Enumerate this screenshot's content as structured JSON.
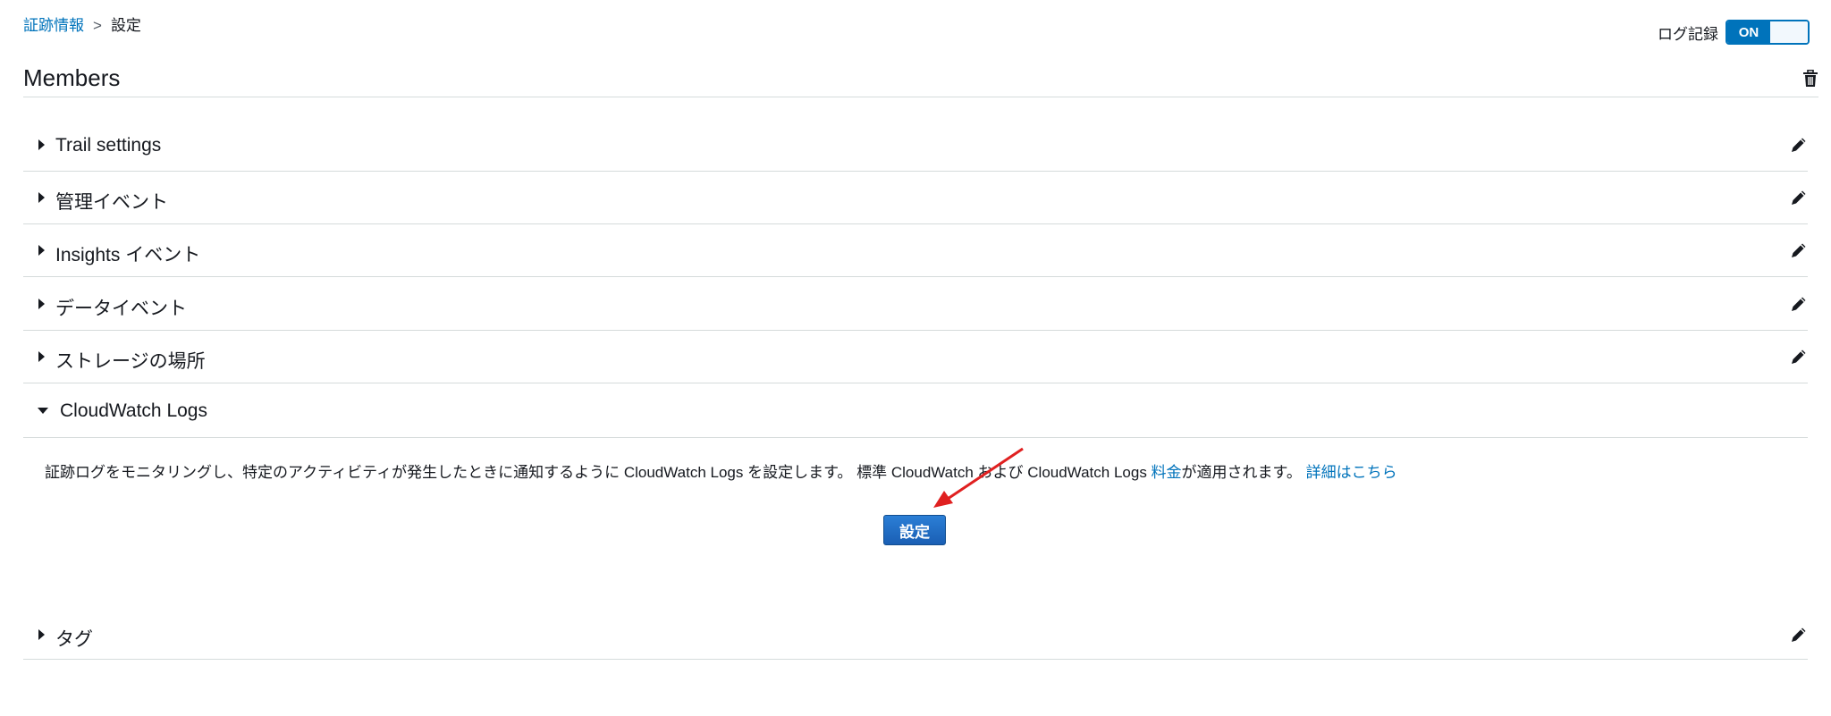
{
  "breadcrumb": {
    "parent": "証跡情報",
    "separator": ">",
    "current": "設定"
  },
  "logging": {
    "label": "ログ記録",
    "toggle_state": "ON"
  },
  "page": {
    "title": "Members"
  },
  "sections": [
    {
      "label": "Trail settings"
    },
    {
      "label": "管理イベント"
    },
    {
      "label": "Insights イベント"
    },
    {
      "label": "データイベント"
    },
    {
      "label": "ストレージの場所"
    },
    {
      "label": "CloudWatch Logs"
    },
    {
      "label": "タグ"
    }
  ],
  "cloudwatch": {
    "text_1": "証跡ログをモニタリングし、特定のアクティビティが発生したときに通知するように CloudWatch Logs を設定します。 標準 CloudWatch および CloudWatch Logs ",
    "pricing_link": "料金",
    "text_2": "が適用されます。 ",
    "details_link": "詳細はこちら",
    "configure_button": "設定"
  },
  "colors": {
    "accent": "#0073bb",
    "annotation": "#e02020"
  },
  "icons": {
    "delete": "trash-icon",
    "edit": "pencil-icon",
    "collapsed": "caret-right-icon",
    "expanded": "caret-down-icon"
  }
}
